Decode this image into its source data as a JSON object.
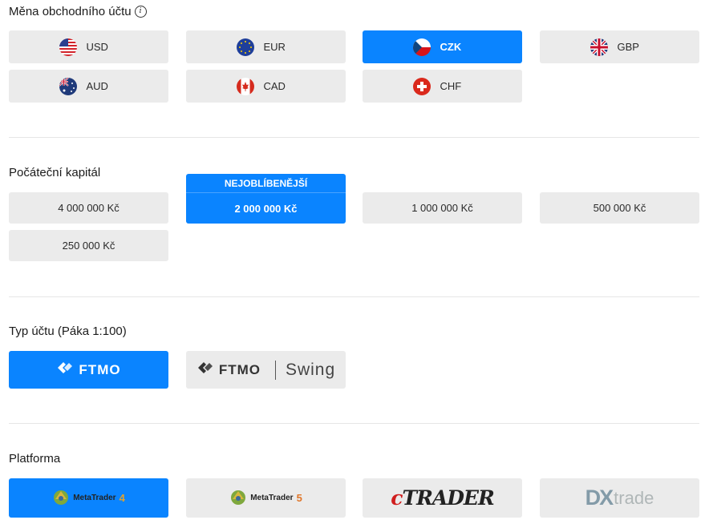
{
  "currency": {
    "title": "Měna obchodního účtu",
    "items": [
      {
        "code": "USD",
        "flag": "us-flag-icon"
      },
      {
        "code": "EUR",
        "flag": "eu-flag-icon"
      },
      {
        "code": "CZK",
        "flag": "cz-flag-icon",
        "selected": true
      },
      {
        "code": "GBP",
        "flag": "gb-flag-icon"
      },
      {
        "code": "AUD",
        "flag": "au-flag-icon"
      },
      {
        "code": "CAD",
        "flag": "ca-flag-icon"
      },
      {
        "code": "CHF",
        "flag": "ch-flag-icon"
      }
    ]
  },
  "capital": {
    "title": "Počáteční kapitál",
    "badge": "NEJOBLÍBENĚJŠÍ",
    "items": [
      "4 000 000 Kč",
      "2 000 000 Kč",
      "1 000 000 Kč",
      "500 000 Kč",
      "250 000 Kč"
    ],
    "selected": "2 000 000 Kč"
  },
  "account_type": {
    "title": "Typ účtu (Páka 1:100)",
    "items": [
      {
        "brand": "FTMO",
        "selected": true
      },
      {
        "brand": "FTMO",
        "suffix": "Swing"
      }
    ]
  },
  "platform": {
    "title": "Platforma",
    "items": [
      {
        "name": "MetaTrader",
        "version": "4",
        "selected": true
      },
      {
        "name": "MetaTrader",
        "version": "5"
      },
      {
        "name": "TRADER",
        "prefix": "c"
      },
      {
        "name": "trade",
        "prefix": "DX"
      }
    ]
  },
  "colors": {
    "accent": "#0a84ff",
    "option_bg": "#ebebeb"
  }
}
